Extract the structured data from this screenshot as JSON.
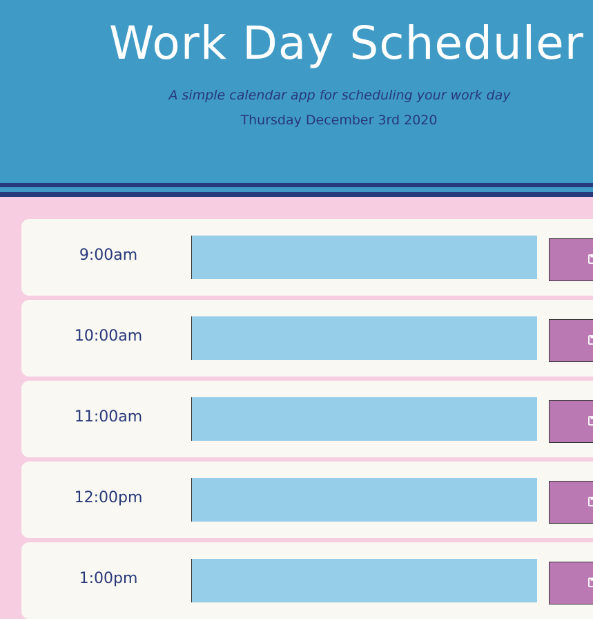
{
  "header": {
    "title": "Work Day Scheduler",
    "subtitle": "A simple calendar app for scheduling your work day",
    "date": "Thursday December 3rd 2020"
  },
  "colors": {
    "header_bg": "#3f9bc6",
    "stripe": "#263a7c",
    "page_bg": "#f6cde1",
    "row_bg": "#f9f8f3",
    "event_future": "#96cde9",
    "save_button": "#bb79b4",
    "text_dark": "#283879"
  },
  "schedule": {
    "rows": [
      {
        "hour": "9:00am",
        "event": "",
        "save_icon": "floppy-disk-icon"
      },
      {
        "hour": "10:00am",
        "event": "",
        "save_icon": "floppy-disk-icon"
      },
      {
        "hour": "11:00am",
        "event": "",
        "save_icon": "floppy-disk-icon"
      },
      {
        "hour": "12:00pm",
        "event": "",
        "save_icon": "floppy-disk-icon"
      },
      {
        "hour": "1:00pm",
        "event": "",
        "save_icon": "floppy-disk-icon"
      }
    ]
  }
}
